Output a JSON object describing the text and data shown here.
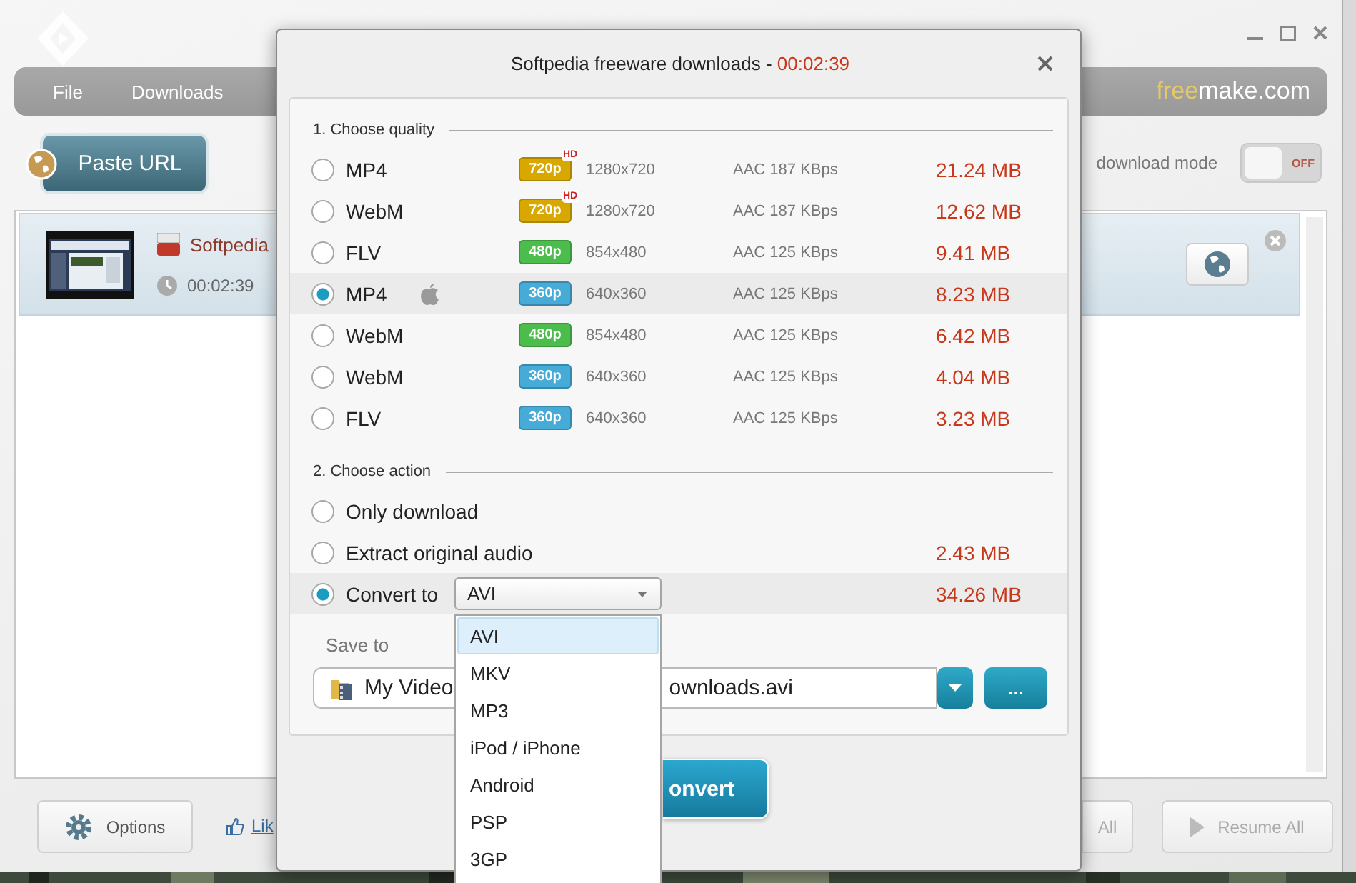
{
  "menu": [
    {
      "label": "File"
    },
    {
      "label": "Downloads"
    }
  ],
  "brand": {
    "prefix": "free",
    "suffix": "make.com"
  },
  "paste_button": {
    "label": "Paste URL"
  },
  "mode_toggle": {
    "label": "download mode",
    "on": false,
    "state_text": "OFF"
  },
  "downloads": [
    {
      "title": "Softpedia",
      "duration": "00:02:39",
      "selected": true
    }
  ],
  "bottom_bar": {
    "options": "Options",
    "like": "Lik",
    "pause_all": {
      "label": "All",
      "disabled": true
    },
    "resume_all": {
      "label": "Resume All",
      "disabled": true
    }
  },
  "dialog": {
    "title": "Softpedia freeware downloads - ",
    "timer": "00:02:39",
    "quality_heading": "1. Choose quality",
    "qualities": [
      {
        "format": "MP4",
        "apple": false,
        "badge": "720p",
        "color": "#d8a800",
        "hd_mark": "HD",
        "resolution": "1280x720",
        "audio": "AAC 187 KBps",
        "size": "21.24 MB",
        "selected": false
      },
      {
        "format": "WebM",
        "apple": false,
        "badge": "720p",
        "color": "#d8a800",
        "hd_mark": "HD",
        "resolution": "1280x720",
        "audio": "AAC 187 KBps",
        "size": "12.62 MB",
        "selected": false
      },
      {
        "format": "FLV",
        "apple": false,
        "badge": "480p",
        "color": "#4cbc4c",
        "resolution": "854x480",
        "audio": "AAC 125 KBps",
        "size": "9.41 MB",
        "selected": false
      },
      {
        "format": "MP4",
        "apple": true,
        "badge": "360p",
        "color": "#46abd6",
        "resolution": "640x360",
        "audio": "AAC 125 KBps",
        "size": "8.23 MB",
        "selected": true
      },
      {
        "format": "WebM",
        "apple": false,
        "badge": "480p",
        "color": "#4cbc4c",
        "resolution": "854x480",
        "audio": "AAC 125 KBps",
        "size": "6.42 MB",
        "selected": false
      },
      {
        "format": "WebM",
        "apple": false,
        "badge": "360p",
        "color": "#46abd6",
        "resolution": "640x360",
        "audio": "AAC 125 KBps",
        "size": "4.04 MB",
        "selected": false
      },
      {
        "format": "FLV",
        "apple": false,
        "badge": "360p",
        "color": "#46abd6",
        "resolution": "640x360",
        "audio": "AAC 125 KBps",
        "size": "3.23 MB",
        "selected": false
      }
    ],
    "action_heading": "2. Choose action",
    "actions": [
      {
        "kind": "plain",
        "label": "Only download",
        "selected": false
      },
      {
        "kind": "plain",
        "label": "Extract original audio",
        "size": "2.43 MB",
        "selected": false
      },
      {
        "kind": "select",
        "label": "Convert to",
        "value": "AVI",
        "size": "34.26 MB",
        "selected": true
      }
    ],
    "save_to": {
      "label": "Save to",
      "path_start": "My Video",
      "path_end": "ownloads.avi",
      "more": "..."
    },
    "convert_button": "onvert",
    "format_options": [
      {
        "label": "AVI",
        "selected": true
      },
      {
        "label": "MKV",
        "selected": false
      },
      {
        "label": "MP3",
        "selected": false
      },
      {
        "label": "iPod / iPhone",
        "selected": false
      },
      {
        "label": "Android",
        "selected": false
      },
      {
        "label": "PSP",
        "selected": false
      },
      {
        "label": "3GP",
        "selected": false
      }
    ]
  }
}
